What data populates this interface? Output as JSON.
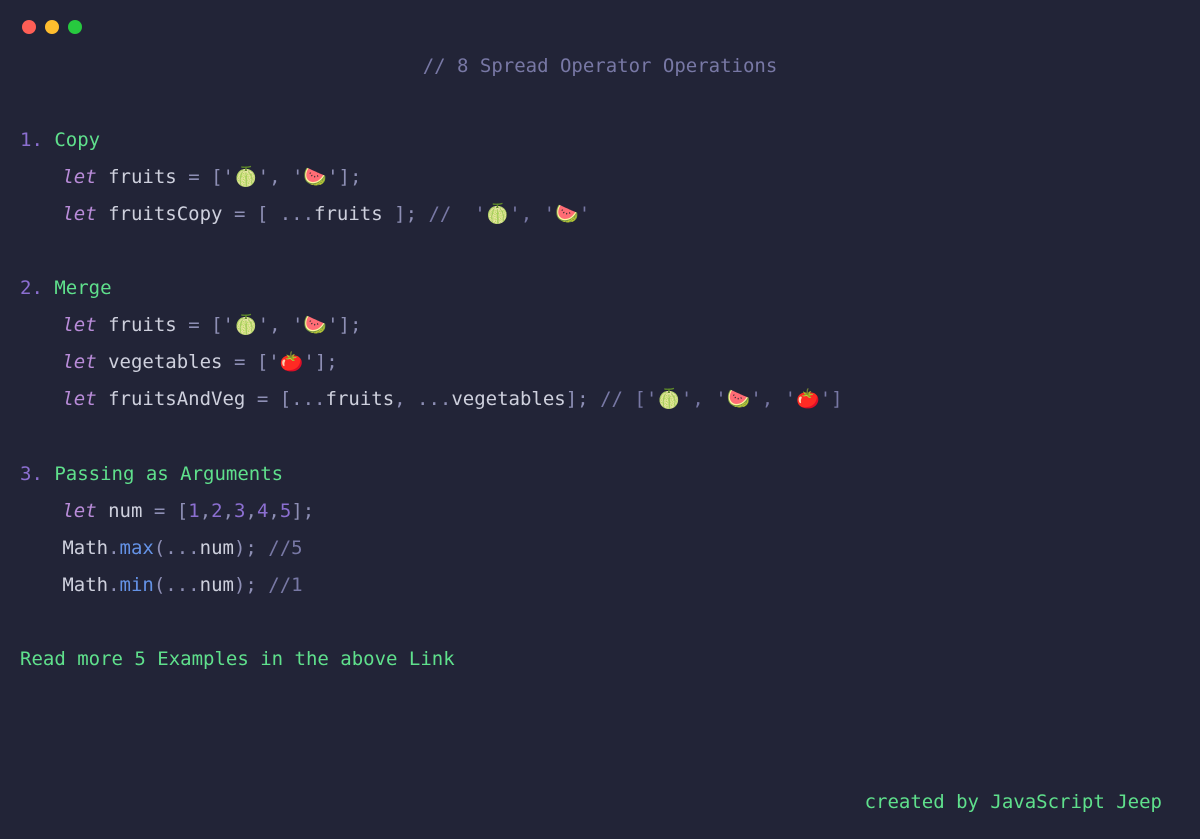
{
  "titleComment": "// 8 Spread Operator Operations",
  "sections": {
    "s1": {
      "num": "1.",
      "title": " Copy",
      "line1": {
        "kw": "let",
        "sp1": " ",
        "ident": "fruits",
        "sp2": " ",
        "eq": "=",
        "sp3": " ",
        "p1": "['",
        "str1": "🍈",
        "p2": "', '",
        "str2": "🍉",
        "p3": "'];"
      },
      "line2": {
        "kw": "let",
        "sp1": " ",
        "ident": "fruitsCopy",
        "sp2": " ",
        "eq": "=",
        "sp3": " ",
        "p1": "[ ...",
        "var1": "fruits",
        "p2": " ]; ",
        "comment": "//  '🍈', '🍉'"
      }
    },
    "s2": {
      "num": "2.",
      "title": " Merge",
      "line1": {
        "kw": "let",
        "sp1": " ",
        "ident": "fruits",
        "sp2": " ",
        "eq": "=",
        "sp3": " ",
        "p1": "['",
        "str1": "🍈",
        "p2": "', '",
        "str2": "🍉",
        "p3": "'];"
      },
      "line2": {
        "kw": "let",
        "sp1": " ",
        "ident": "vegetables",
        "sp2": " ",
        "eq": "=",
        "sp3": " ",
        "p1": "['",
        "str1": "🍅",
        "p2": "'];"
      },
      "line3": {
        "kw": "let",
        "sp1": " ",
        "ident": "fruitsAndVeg",
        "sp2": " ",
        "eq": "=",
        "sp3": " ",
        "p1": "[...",
        "var1": "fruits",
        "p2": ", ...",
        "var2": "vegetables",
        "p3": "]; ",
        "comment": "// ['🍈', '🍉', '🍅']"
      }
    },
    "s3": {
      "num": "3.",
      "title": " Passing as Arguments",
      "line1": {
        "kw": "let",
        "sp1": " ",
        "ident": "num",
        "sp2": " ",
        "eq": "=",
        "sp3": " ",
        "p1": "[",
        "n1": "1",
        "c1": ",",
        "n2": "2",
        "c2": ",",
        "n3": "3",
        "c3": ",",
        "n4": "4",
        "c4": ",",
        "n5": "5",
        "p2": "];"
      },
      "line2": {
        "obj": "Math",
        "dot": ".",
        "meth": "max",
        "p1": "(...",
        "var1": "num",
        "p2": "); ",
        "comment": "//5"
      },
      "line3": {
        "obj": "Math",
        "dot": ".",
        "meth": "min",
        "p1": "(...",
        "var1": "num",
        "p2": "); ",
        "comment": "//1"
      }
    }
  },
  "footer": "Read more 5 Examples in the above Link",
  "credit": "created by JavaScript Jeep"
}
